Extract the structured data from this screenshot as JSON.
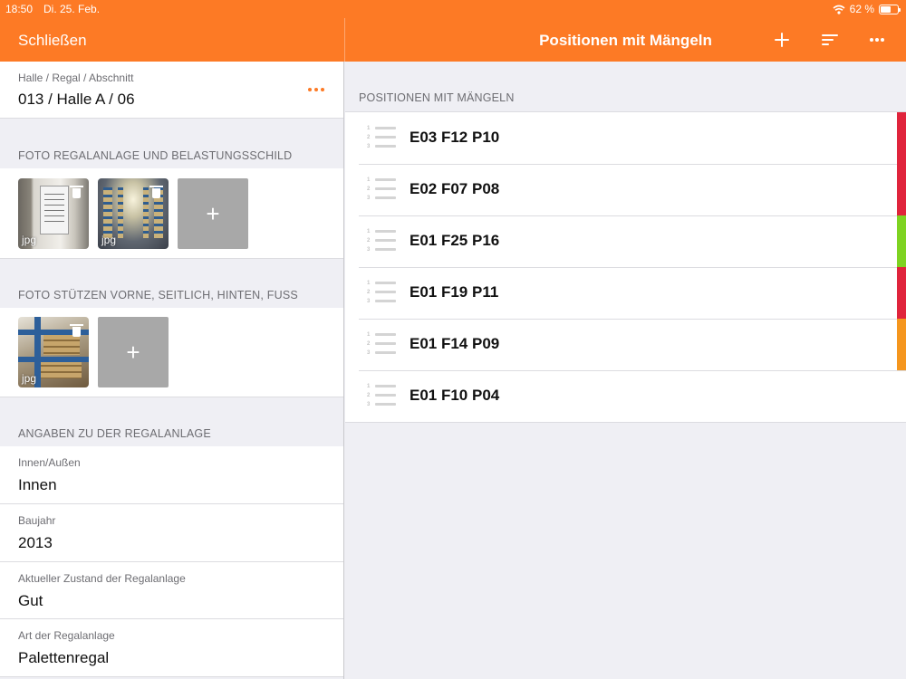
{
  "status_bar": {
    "time": "18:50",
    "date": "Di. 25. Feb.",
    "battery": "62 %",
    "battery_level": 0.62
  },
  "nav": {
    "close_label": "Schließen",
    "title": "Positionen mit Mängeln"
  },
  "location": {
    "label": "Halle / Regal / Abschnitt",
    "value": "013 / Halle A / 06"
  },
  "photo_section_1": {
    "header": "FOTO REGALANLAGE UND BELASTUNGSSCHILD",
    "thumbs": [
      {
        "ext": "jpg"
      },
      {
        "ext": "jpg"
      }
    ],
    "add": "+"
  },
  "photo_section_2": {
    "header": "FOTO STÜTZEN VORNE, SEITLICH, HINTEN, FUSS",
    "thumbs": [
      {
        "ext": "jpg"
      }
    ],
    "add": "+"
  },
  "details": {
    "header": "ANGABEN ZU DER REGALANLAGE",
    "fields": [
      {
        "label": "Innen/Außen",
        "value": "Innen"
      },
      {
        "label": "Baujahr",
        "value": "2013"
      },
      {
        "label": "Aktueller Zustand der Regalanlage",
        "value": "Gut"
      },
      {
        "label": "Art der Regalanlage",
        "value": "Palettenregal"
      }
    ]
  },
  "positions": {
    "header": "POSITIONEN MIT MÄNGELN",
    "list_icon_numbers": [
      "1",
      "2",
      "3"
    ],
    "items": [
      {
        "label": "E03 F12 P10",
        "status_color": "#e0243c"
      },
      {
        "label": "E02 F07 P08",
        "status_color": "#e0243c"
      },
      {
        "label": "E01 F25 P16",
        "status_color": "#7ed321"
      },
      {
        "label": "E01 F19 P11",
        "status_color": "#e0243c"
      },
      {
        "label": "E01 F14 P09",
        "status_color": "#f5961e"
      },
      {
        "label": "E01 F10 P04",
        "status_color": ""
      }
    ]
  },
  "colors": {
    "accent": "#fd7a25",
    "background": "#efeff4"
  }
}
